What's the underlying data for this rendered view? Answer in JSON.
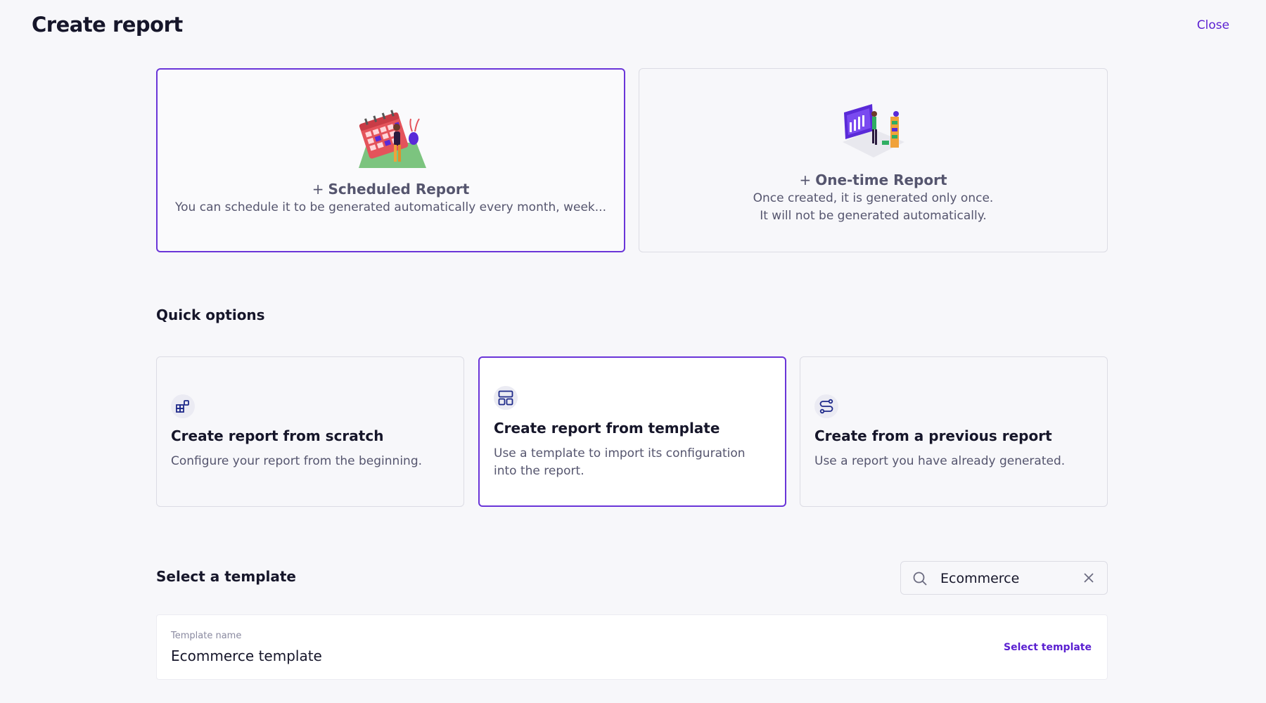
{
  "header": {
    "title": "Create report",
    "close_label": "Close"
  },
  "report_types": {
    "scheduled": {
      "plus": "+",
      "title": "Scheduled Report",
      "description": "You can schedule it to be generated automatically every month, week...",
      "selected": true
    },
    "onetime": {
      "plus": "+",
      "title": "One-time Report",
      "description_line1": "Once created, it is generated only once.",
      "description_line2": "It will not be generated automatically.",
      "selected": false
    }
  },
  "quick_options": {
    "heading": "Quick options",
    "items": [
      {
        "icon": "grid-blocks-icon",
        "title": "Create report from scratch",
        "description": "Configure your report from the beginning.",
        "selected": false
      },
      {
        "icon": "layout-template-icon",
        "title": "Create report from template",
        "description": "Use a template to import its configuration into the report.",
        "selected": true
      },
      {
        "icon": "route-icon",
        "title": "Create from a previous report",
        "description": "Use a report you have already generated.",
        "selected": false
      }
    ]
  },
  "template_section": {
    "heading": "Select a template",
    "search": {
      "value": "Ecommerce"
    },
    "column_label": "Template name",
    "rows": [
      {
        "name": "Ecommerce template",
        "action": "Select template"
      }
    ]
  },
  "colors": {
    "accent": "#6a35d8",
    "link": "#5a1fd1",
    "icon_navy": "#1f2a8a"
  }
}
